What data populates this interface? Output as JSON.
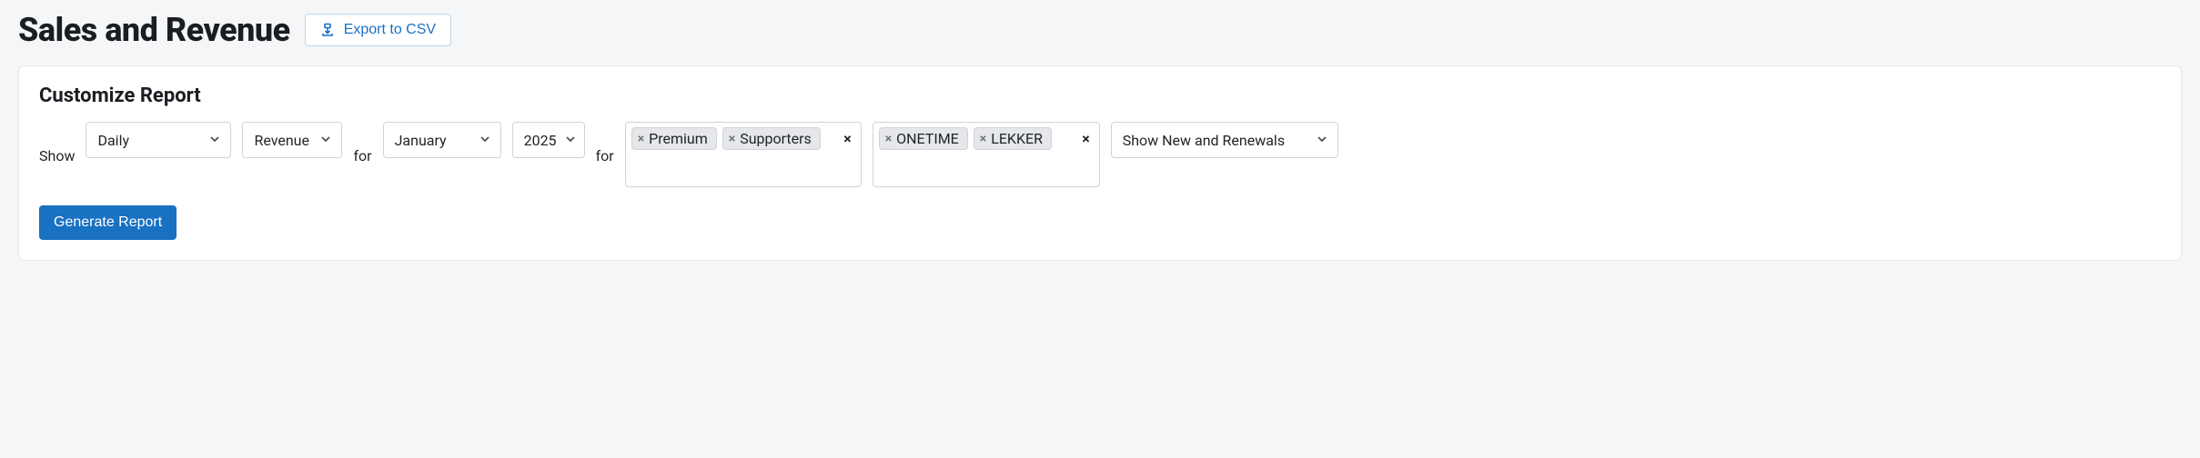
{
  "header": {
    "title": "Sales and Revenue",
    "export_label": "Export to CSV"
  },
  "card": {
    "title": "Customize Report",
    "show_label": "Show",
    "for_label_1": "for",
    "for_label_2": "for",
    "frequency": "Daily",
    "metric": "Revenue",
    "month": "January",
    "year": "2025",
    "tagbox1": {
      "tags": [
        "Premium",
        "Supporters"
      ]
    },
    "tagbox2": {
      "tags": [
        "ONETIME",
        "LEKKER"
      ]
    },
    "renewals": "Show New and Renewals",
    "generate_label": "Generate Report"
  }
}
